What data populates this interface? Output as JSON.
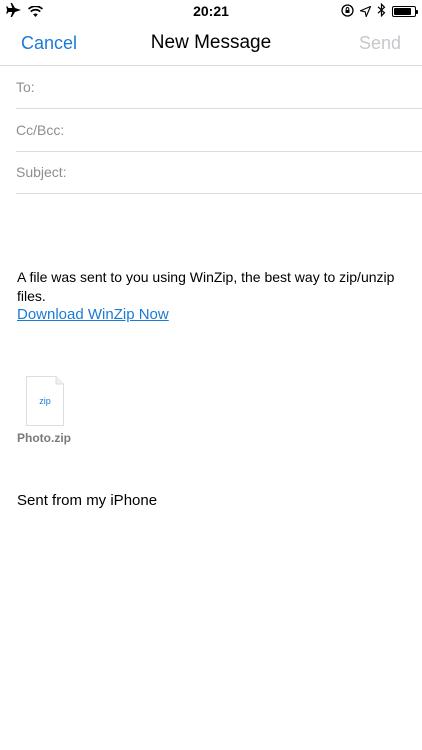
{
  "status_bar": {
    "time": "20:21",
    "icons": [
      "airplane-icon",
      "wifi-icon",
      "orientation-lock-icon",
      "location-icon",
      "bluetooth-icon",
      "battery-icon"
    ],
    "battery_level": 0.85
  },
  "nav": {
    "cancel_label": "Cancel",
    "title": "New Message",
    "send_label": "Send"
  },
  "fields": {
    "to_label": "To:",
    "cc_label": "Cc/Bcc:",
    "subject_label": "Subject:"
  },
  "body": {
    "message": "A file was sent to you using WinZip, the best way to zip/unzip files.",
    "link_text": "Download WinZip Now",
    "signature": "Sent from my iPhone"
  },
  "attachment": {
    "extension": "zip",
    "filename": "Photo.zip"
  },
  "colors": {
    "accent": "#1a7bd6",
    "disabled": "#c7c7cc",
    "label": "#8e8e93"
  }
}
